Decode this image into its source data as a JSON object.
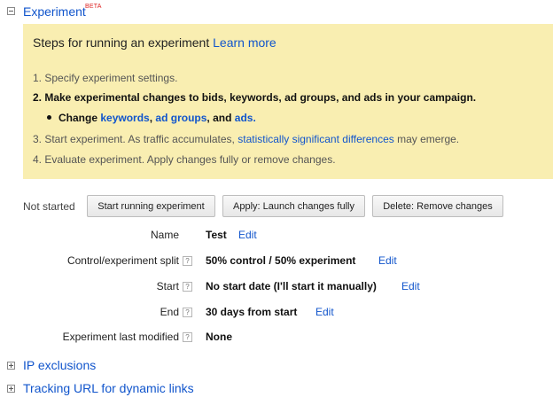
{
  "section": {
    "title": "Experiment",
    "badge": "BETA"
  },
  "steps": {
    "heading_text": "Steps for running an experiment",
    "learn_more": "Learn more",
    "step1": "1. Specify experiment settings.",
    "step2": "2. Make experimental changes to bids, keywords, ad groups, and ads in your campaign.",
    "substep": {
      "prefix": "Change",
      "keywords_link": "keywords",
      "comma1": ",",
      "ad_groups_link": "ad groups",
      "and_text": ", and",
      "ads_link": "ads",
      "period": "."
    },
    "step3": {
      "before": "3. Start experiment. As traffic accumulates,",
      "link": "statistically significant differences",
      "after": "may emerge."
    },
    "step4": "4. Evaluate experiment. Apply changes fully or remove changes."
  },
  "status": {
    "label": "Not started",
    "buttons": {
      "start": "Start running experiment",
      "apply": "Apply: Launch changes fully",
      "delete": "Delete: Remove changes"
    }
  },
  "settings": {
    "name": {
      "label": "Name",
      "value": "Test",
      "edit": "Edit"
    },
    "split": {
      "label": "Control/experiment split",
      "help": "?",
      "value": "50% control / 50% experiment",
      "edit": "Edit"
    },
    "start": {
      "label": "Start",
      "help": "?",
      "value": "No start date (I'll start it manually)",
      "edit": "Edit"
    },
    "end": {
      "label": "End",
      "help": "?",
      "value": "30 days from start",
      "edit": "Edit"
    },
    "modified": {
      "label": "Experiment last modified",
      "help": "?",
      "value": "None"
    }
  },
  "collapsed_sections": {
    "ip_exclusions": "IP exclusions",
    "tracking_url": "Tracking URL for dynamic links"
  },
  "colors": {
    "link": "#1155cc",
    "steps_background": "#f9eeb1",
    "beta_badge": "#dd2222"
  },
  "icons": {
    "section_toggle": "minus-box-icon",
    "collapsed_toggle": "plus-box-icon",
    "help": "question-mark-icon",
    "bullet": "bullet-icon"
  }
}
